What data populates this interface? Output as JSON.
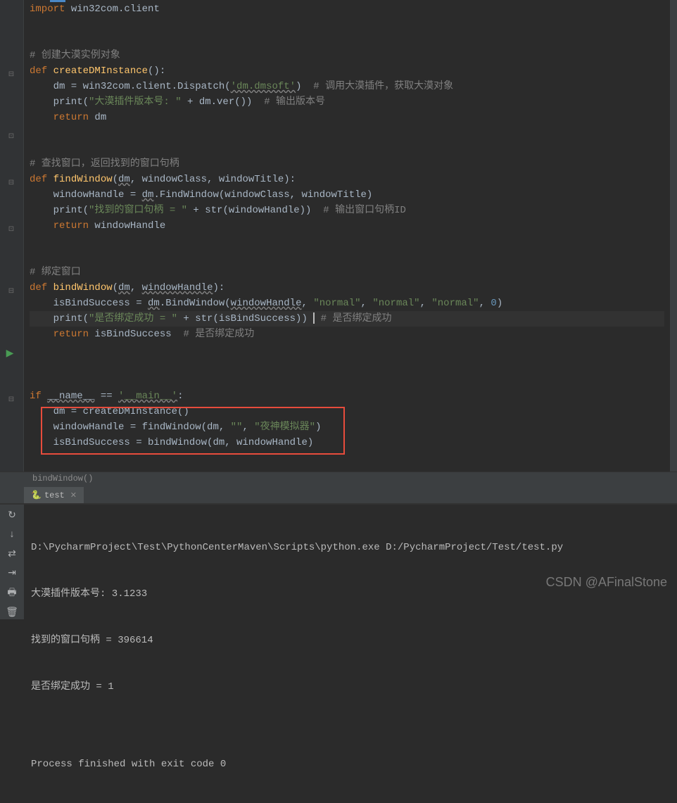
{
  "code": {
    "import_line": "import win32com.client",
    "comment1": "# 创建大漠实例对象",
    "fn1_def_kw": "def ",
    "fn1_name": "createDMInstance",
    "fn1_sig": "():",
    "fn1_l1_a": "    dm = win32com.client.Dispatch(",
    "fn1_l1_str": "'dm.dmsoft'",
    "fn1_l1_b": ")  ",
    "fn1_l1_c": "# 调用大漠插件，获取大漠对象",
    "fn1_l2_a": "    print(",
    "fn1_l2_str": "\"大漠插件版本号: \"",
    "fn1_l2_b": " + dm.ver())  ",
    "fn1_l2_c": "# 输出版本号",
    "fn1_l3_a": "    ",
    "fn1_l3_kw": "return",
    "fn1_l3_b": " dm",
    "comment2": "# 查找窗口，返回找到的窗口句柄",
    "fn2_name": "findWindow",
    "fn2_sig_a": "(",
    "fn2_p1": "dm",
    "fn2_sig_b": ", windowClass, windowTitle):",
    "fn2_l1_a": "    windowHandle = ",
    "fn2_l1_p": "dm",
    "fn2_l1_b": ".FindWindow(windowClass, windowTitle)",
    "fn2_l2_a": "    print(",
    "fn2_l2_str": "\"找到的窗口句柄 = \"",
    "fn2_l2_b": " + str(windowHandle))  ",
    "fn2_l2_c": "# 输出窗口句柄ID",
    "fn2_l3_a": "    ",
    "fn2_l3_kw": "return",
    "fn2_l3_b": " windowHandle",
    "comment3": "# 绑定窗口",
    "fn3_name": "bindWindow",
    "fn3_sig_a": "(",
    "fn3_p1": "dm",
    "fn3_sig_b": ", ",
    "fn3_p2": "windowHandle",
    "fn3_sig_c": "):",
    "fn3_l1_a": "    isBindSuccess = ",
    "fn3_l1_p1": "dm",
    "fn3_l1_b": ".BindWindow(",
    "fn3_l1_p2": "windowHandle",
    "fn3_l1_c": ", ",
    "fn3_l1_s1": "\"normal\"",
    "fn3_l1_d": ", ",
    "fn3_l1_s2": "\"normal\"",
    "fn3_l1_e": ", ",
    "fn3_l1_s3": "\"normal\"",
    "fn3_l1_f": ", ",
    "fn3_l1_n": "0",
    "fn3_l1_g": ")",
    "fn3_l2_a": "    print(",
    "fn3_l2_str": "\"是否绑定成功 = \"",
    "fn3_l2_b": " + str(isBindSuccess)) ",
    "fn3_l2_c": "# 是否绑定成功",
    "fn3_l3_a": "    ",
    "fn3_l3_kw": "return",
    "fn3_l3_b": " isBindSuccess  ",
    "fn3_l3_c": "# 是否绑定成功",
    "main_if_kw": "if",
    "main_if_a": " ",
    "main_name": "__name__",
    "main_if_b": " == ",
    "main_str": "'__main__'",
    "main_if_c": ":",
    "main_l1": "    dm = createDMInstance()",
    "main_l2_a": "    windowHandle = findWindow(dm, ",
    "main_l2_s1": "\"\"",
    "main_l2_b": ", ",
    "main_l2_s2": "\"夜神模拟器\"",
    "main_l2_c": ")",
    "main_l3": "    isBindSuccess = bindWindow(dm, windowHandle)"
  },
  "breadcrumb": "bindWindow()",
  "run_tab": "test",
  "console": {
    "l1": "D:\\PycharmProject\\Test\\PythonCenterMaven\\Scripts\\python.exe D:/PycharmProject/Test/test.py",
    "l2": "大漠插件版本号: 3.1233",
    "l3": "找到的窗口句柄 = 396614",
    "l4": "是否绑定成功 = 1",
    "l5": "",
    "l6": "Process finished with exit code 0"
  },
  "watermark": "CSDN @AFinalStone"
}
